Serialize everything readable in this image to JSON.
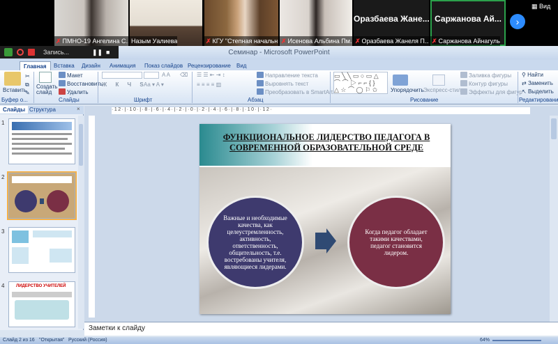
{
  "zoom": {
    "participants": [
      {
        "name": "ПМНО-19 Ангелина С...",
        "muted": true
      },
      {
        "name": "Назым Уалиева",
        "muted": false
      },
      {
        "name": "КГУ \"Степная начальн...",
        "muted": true
      },
      {
        "name": "Исенова Альбина Пм...",
        "muted": true
      },
      {
        "big": "Оразбаева Жане...",
        "name": "Оразбаева Жанеля П...",
        "muted": true
      },
      {
        "big": "Саржанова Ай...",
        "name": "Саржанова Айнагуль",
        "muted": true
      }
    ],
    "view_label": "Вид",
    "next_icon": "›"
  },
  "recording": {
    "label": "Запись..."
  },
  "window": {
    "title": "Семинар - Microsoft PowerPoint"
  },
  "ribbon": {
    "tabs": [
      "Главная",
      "Вставка",
      "Дизайн",
      "Анимация",
      "Показ слайдов",
      "Рецензирование",
      "Вид"
    ],
    "clipboard": {
      "paste": "Вставить",
      "cut": "",
      "copy": "",
      "label": "Буфер о..."
    },
    "slides": {
      "create": "Создать слайд",
      "layout": "Макет",
      "restore": "Восстановить",
      "delete": "Удалить",
      "label": "Слайды"
    },
    "font": {
      "label": "Шрифт"
    },
    "paragraph": {
      "direction": "Направление текста",
      "align": "Выровнять текст",
      "smartart": "Преобразовать в SmartArt",
      "label": "Абзац"
    },
    "drawing": {
      "arrange": "Упорядочить",
      "styles": "Экспресс-стили",
      "fill": "Заливка фигуры",
      "outline": "Контур фигуры",
      "effects": "Эффекты для фигур",
      "label": "Рисование"
    },
    "editing": {
      "find": "Найти",
      "replace": "Заменить",
      "select": "Выделить",
      "label": "Редактирование"
    }
  },
  "left_pane": {
    "tab_slides": "Слайды",
    "tab_outline": "Структура",
    "slide_numbers": [
      "1",
      "2",
      "3",
      "4"
    ],
    "thumb4_title": "ЛИДЕРСТВО УЧИТЕЛЕЙ"
  },
  "ruler_text": "·12·|·10·|·8·|·6·|·4·|·2·|·0·|·2·|·4·|·6·|·8·|·10·|·12·",
  "slide": {
    "title": "ФУНКЦИОНАЛЬНОЕ ЛИДЕРСТВО ПЕДАГОГА В СОВРЕМЕННОЙ ОБРАЗОВАТЕЛЬНОЙ СРЕДЕ",
    "left_circle": "Важные и необходимые качества, как целеустремленность, активность, ответственность, общительность, т.е. востребованы учителя, являющиеся лидерами.",
    "right_circle": "Когда педагог обладает такими качествами, педагог становится лидером.",
    "colors": {
      "left_circle": "#3e3a6e",
      "right_circle": "#7a2f45",
      "arrow": "#2f4a73",
      "title_band": "#2a8a8f"
    }
  },
  "notes": {
    "placeholder": "Заметки к слайду"
  },
  "status": {
    "slide": "Слайд 2 из 16",
    "theme": "\"Открытая\"",
    "lang": "Русский (Россия)",
    "zoom": "64%"
  }
}
